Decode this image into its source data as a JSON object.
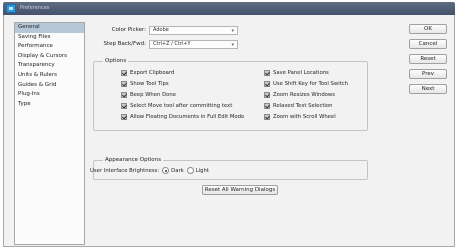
{
  "window": {
    "title": "Preferences",
    "icon": "photoshop-app-icon"
  },
  "sidebar": {
    "items": [
      {
        "label": "General",
        "selected": true
      },
      {
        "label": "Saving Files"
      },
      {
        "label": "Performance"
      },
      {
        "label": "Display & Cursors"
      },
      {
        "label": "Transparency"
      },
      {
        "label": "Units & Rulers"
      },
      {
        "label": "Guides & Grid"
      },
      {
        "label": "Plug-Ins"
      },
      {
        "label": "Type"
      }
    ]
  },
  "general": {
    "color_picker_label": "Color Picker:",
    "color_picker_value": "Adobe",
    "step_back_label": "Step Back/Fwd:",
    "step_back_value": "Ctrl+Z / Ctrl+Y"
  },
  "options": {
    "title": "Options",
    "left": [
      "Export Clipboard",
      "Show Tool Tips",
      "Beep When Done",
      "Select Move tool after committing text",
      "Allow Floating Documents in Full Edit Mode"
    ],
    "right": [
      "Save Panel Locations",
      "Use Shift Key for Tool Switch",
      "Zoom Resizes Windows",
      "Relaxed Text Selection",
      "Zoom with Scroll Wheel"
    ]
  },
  "appearance": {
    "title": "Appearance Options",
    "brightness_label": "User Interface Brightness:",
    "dark": "Dark",
    "light": "Light",
    "selected": "Dark"
  },
  "reset_warnings": "Reset All Warning Dialogs",
  "buttons": {
    "ok": "OK",
    "cancel": "Cancel",
    "reset": "Reset",
    "prev": "Prev",
    "next": "Next"
  },
  "colors": {
    "titlebar": "#4f5c73",
    "selection": "#b7c7da",
    "icon": "#2d9bd6"
  }
}
